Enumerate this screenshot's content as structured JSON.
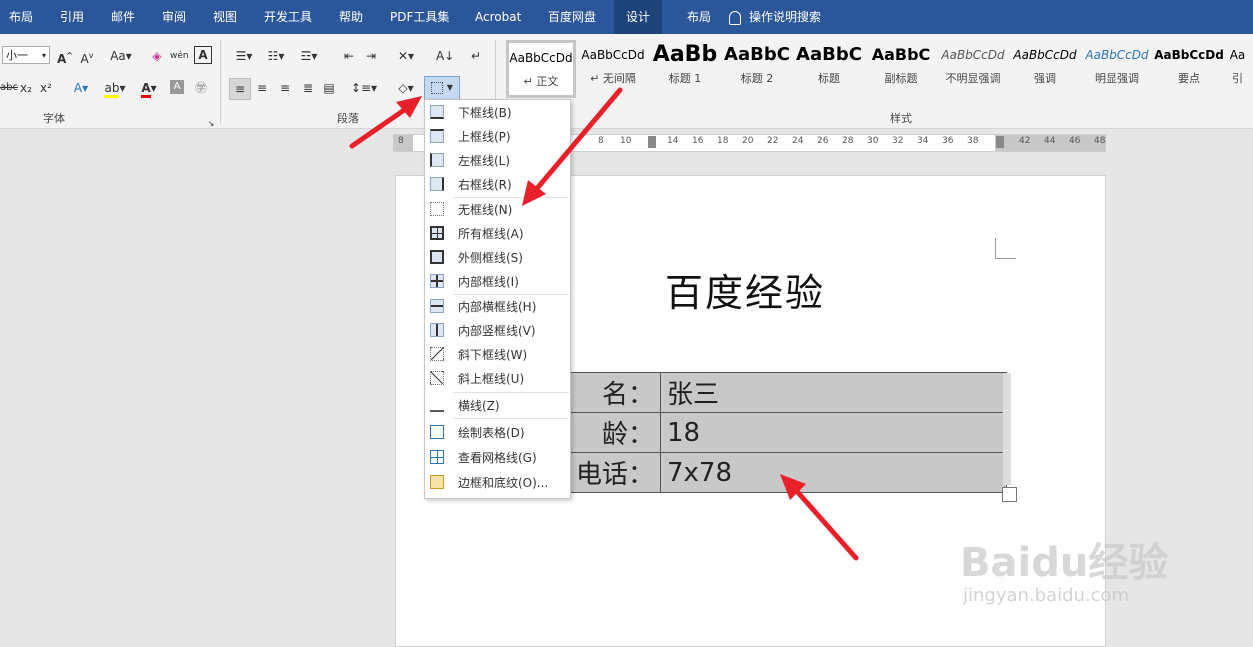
{
  "tabs": [
    "布局",
    "引用",
    "邮件",
    "审阅",
    "视图",
    "开发工具",
    "帮助",
    "PDF工具集",
    "Acrobat",
    "百度网盘",
    "设计",
    "布局"
  ],
  "tell_me": "操作说明搜索",
  "ribbon": {
    "font_size": "小一",
    "group_font": "字体",
    "group_paragraph": "段落",
    "group_styles": "样式"
  },
  "styles": [
    {
      "preview": "AaBbCcDd",
      "name": "↵ 正文"
    },
    {
      "preview": "AaBbCcDd",
      "name": "↵ 无间隔"
    },
    {
      "preview": "AaBb",
      "name": "标题 1"
    },
    {
      "preview": "AaBbC",
      "name": "标题 2"
    },
    {
      "preview": "AaBbC",
      "name": "标题"
    },
    {
      "preview": "AaBbC",
      "name": "副标题"
    },
    {
      "preview": "AaBbCcDd",
      "name": "不明显强调"
    },
    {
      "preview": "AaBbCcDd",
      "name": "强调"
    },
    {
      "preview": "AaBbCcDd",
      "name": "明显强调"
    },
    {
      "preview": "AaBbCcDd",
      "name": "要点"
    },
    {
      "preview": "Aa",
      "name": "引"
    }
  ],
  "ruler_ticks": [
    "8",
    "",
    "",
    "",
    "",
    "",
    "",
    "",
    "8",
    "10",
    "",
    "14",
    "16",
    "18",
    "20",
    "22",
    "24",
    "26",
    "28",
    "30",
    "32",
    "34",
    "36",
    "38",
    "",
    "42",
    "44",
    "46",
    "48"
  ],
  "border_menu": [
    {
      "label": "下框线(B)",
      "icon": "bottom-border-icon"
    },
    {
      "label": "上框线(P)",
      "icon": "top-border-icon"
    },
    {
      "label": "左框线(L)",
      "icon": "left-border-icon"
    },
    {
      "label": "右框线(R)",
      "icon": "right-border-icon"
    },
    {
      "label": "无框线(N)",
      "icon": "no-border-icon"
    },
    {
      "label": "所有框线(A)",
      "icon": "all-borders-icon"
    },
    {
      "label": "外侧框线(S)",
      "icon": "outside-borders-icon"
    },
    {
      "label": "内部框线(I)",
      "icon": "inside-borders-icon"
    },
    {
      "label": "内部横框线(H)",
      "icon": "inside-horizontal-border-icon"
    },
    {
      "label": "内部竖框线(V)",
      "icon": "inside-vertical-border-icon"
    },
    {
      "label": "斜下框线(W)",
      "icon": "diagonal-down-border-icon"
    },
    {
      "label": "斜上框线(U)",
      "icon": "diagonal-up-border-icon"
    },
    {
      "label": "横线(Z)",
      "icon": "horizontal-line-icon"
    },
    {
      "label": "绘制表格(D)",
      "icon": "draw-table-icon"
    },
    {
      "label": "查看网格线(G)",
      "icon": "view-gridlines-icon"
    },
    {
      "label": "边框和底纹(O)...",
      "icon": "borders-shading-icon"
    }
  ],
  "document": {
    "title": "百度经验",
    "rows": [
      {
        "key": "名：",
        "value": "张三"
      },
      {
        "key": "龄：",
        "value": "18"
      },
      {
        "key": "电话：",
        "value": "7x78"
      }
    ]
  },
  "watermark": {
    "logo": "Baidu经验",
    "url": "jingyan.baidu.com"
  }
}
